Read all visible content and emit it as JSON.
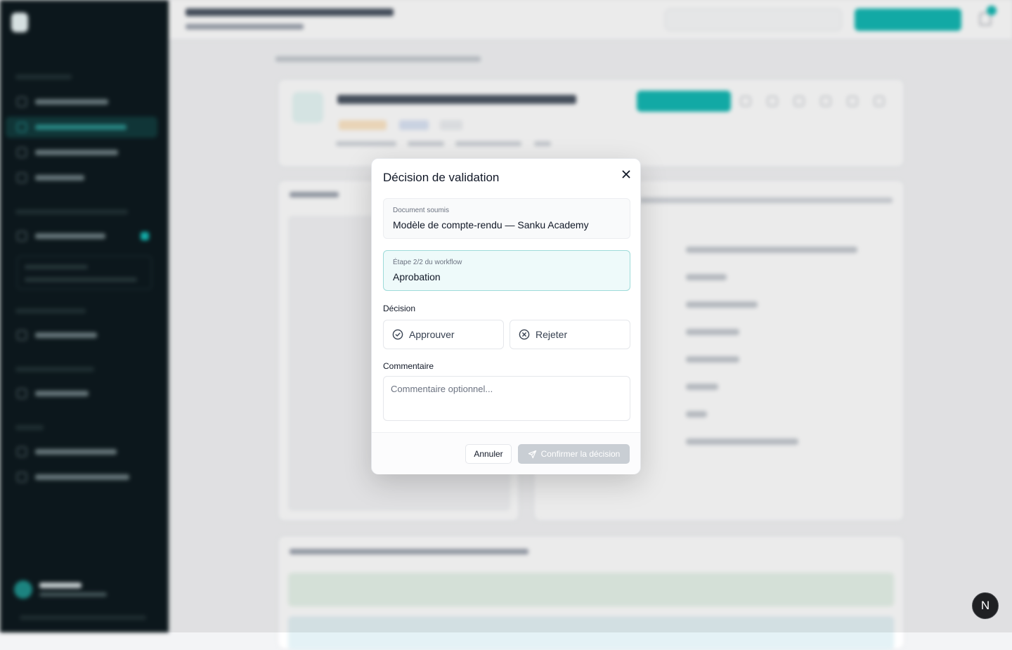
{
  "modal": {
    "title": "Décision de validation",
    "document_label": "Document soumis",
    "document_value": "Modèle de compte-rendu — Sanku Academy",
    "step_label": "Étape 2/2 du workflow",
    "step_value": "Aprobation",
    "decision_label": "Décision",
    "approve_label": "Approuver",
    "reject_label": "Rejeter",
    "comment_label": "Commentaire",
    "comment_placeholder": "Commentaire optionnel...",
    "cancel_label": "Annuler",
    "confirm_label": "Confirmer la décision",
    "confirm_enabled": false
  },
  "fab": {
    "label": "N"
  },
  "colors": {
    "accent": "#14b8b3",
    "sidebar_bg": "#0e1a1f",
    "step_border": "#9edbd9",
    "confirm_disabled": "#c9ced4"
  },
  "icons": {
    "close": "close-icon",
    "approve": "check-circle-icon",
    "reject": "x-circle-icon",
    "confirm": "send-icon"
  }
}
